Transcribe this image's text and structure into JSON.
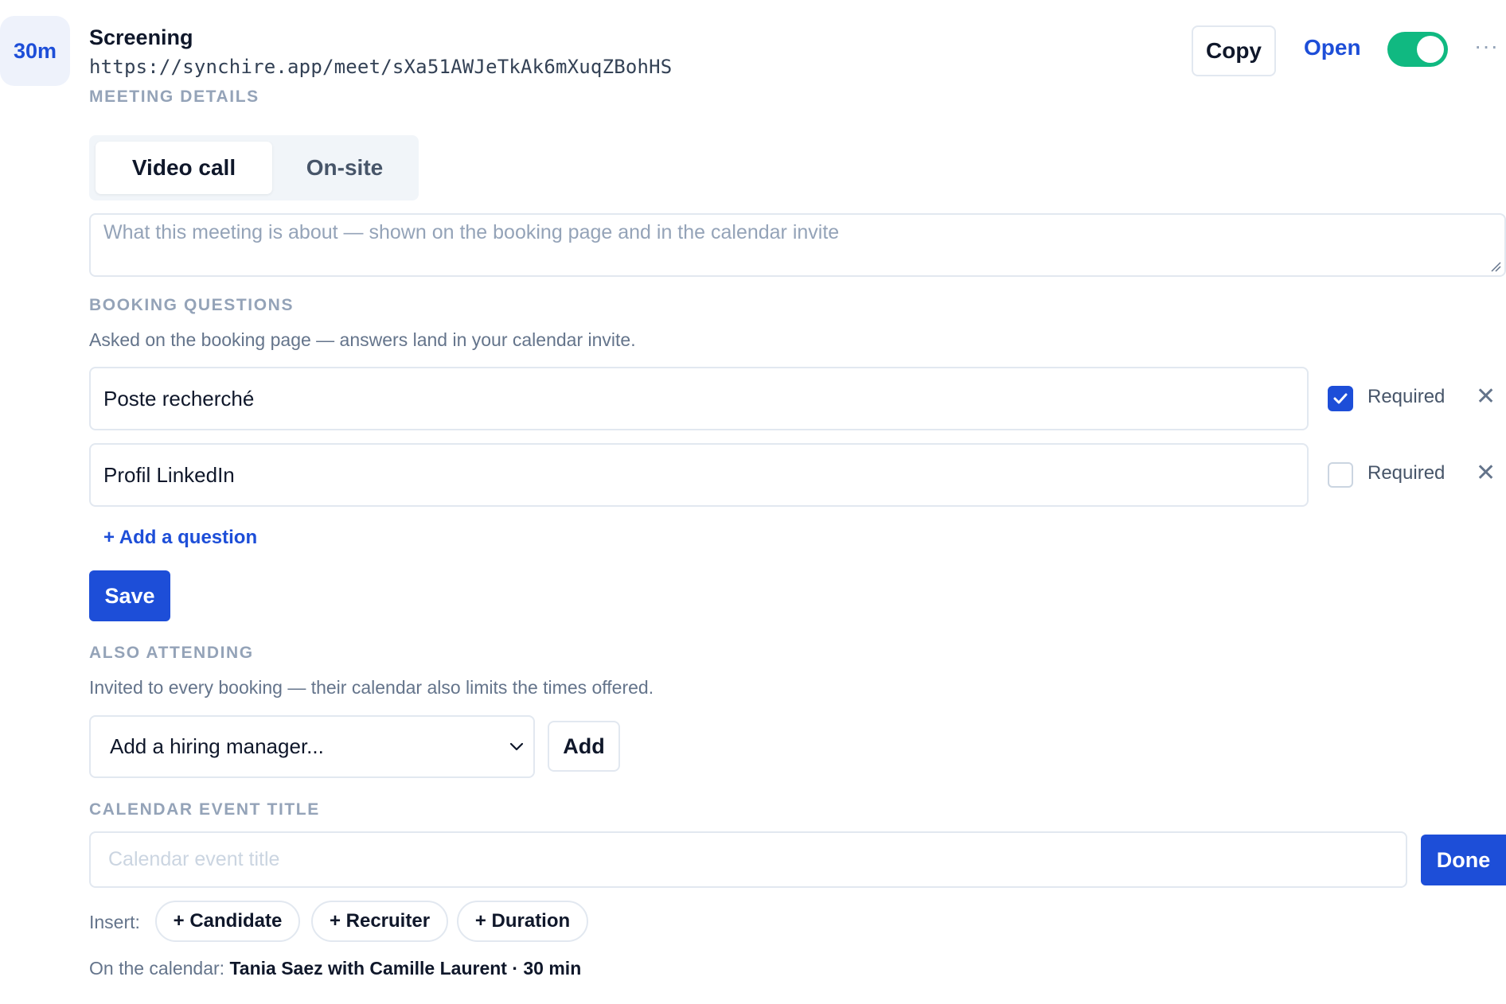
{
  "header": {
    "duration_badge": "30m",
    "title": "Screening",
    "url": "https://synchire.app/meet/sXa51AWJeTkAk6mXuqZBohHS",
    "copy_label": "Copy",
    "open_label": "Open",
    "enabled": true,
    "more_icon": "more-horizontal-icon"
  },
  "meeting_details": {
    "label": "MEETING DETAILS",
    "modes": [
      {
        "label": "Video call",
        "selected": true
      },
      {
        "label": "On-site",
        "selected": false
      }
    ],
    "description_placeholder": "What this meeting is about — shown on the booking page and in the calendar invite"
  },
  "booking_questions": {
    "label": "BOOKING QUESTIONS",
    "description": "Asked on the booking page — answers land in your calendar invite.",
    "questions": [
      {
        "text": "Poste recherché",
        "required": true,
        "required_label": "Required"
      },
      {
        "text": "Profil LinkedIn",
        "required": false,
        "required_label": "Required"
      }
    ],
    "add_label": "+ Add a question",
    "save_label": "Save"
  },
  "also_attending": {
    "label": "ALSO ATTENDING",
    "description": "Invited to every booking — their calendar also limits the times offered.",
    "select_value": "Add a hiring manager...",
    "add_label": "Add"
  },
  "calendar_event": {
    "label": "CALENDAR EVENT TITLE",
    "placeholder": "Calendar event title",
    "done_label": "Done",
    "insert_label": "Insert:",
    "chips": [
      "+ Candidate",
      "+ Recruiter",
      "+ Duration"
    ],
    "preview_prefix": "On the calendar:",
    "preview_value": "Tania Saez with Camille Laurent · 30 min"
  },
  "colors": {
    "accent": "#1d4ed8",
    "toggle_on": "#10b981",
    "muted": "#94a3b8"
  }
}
